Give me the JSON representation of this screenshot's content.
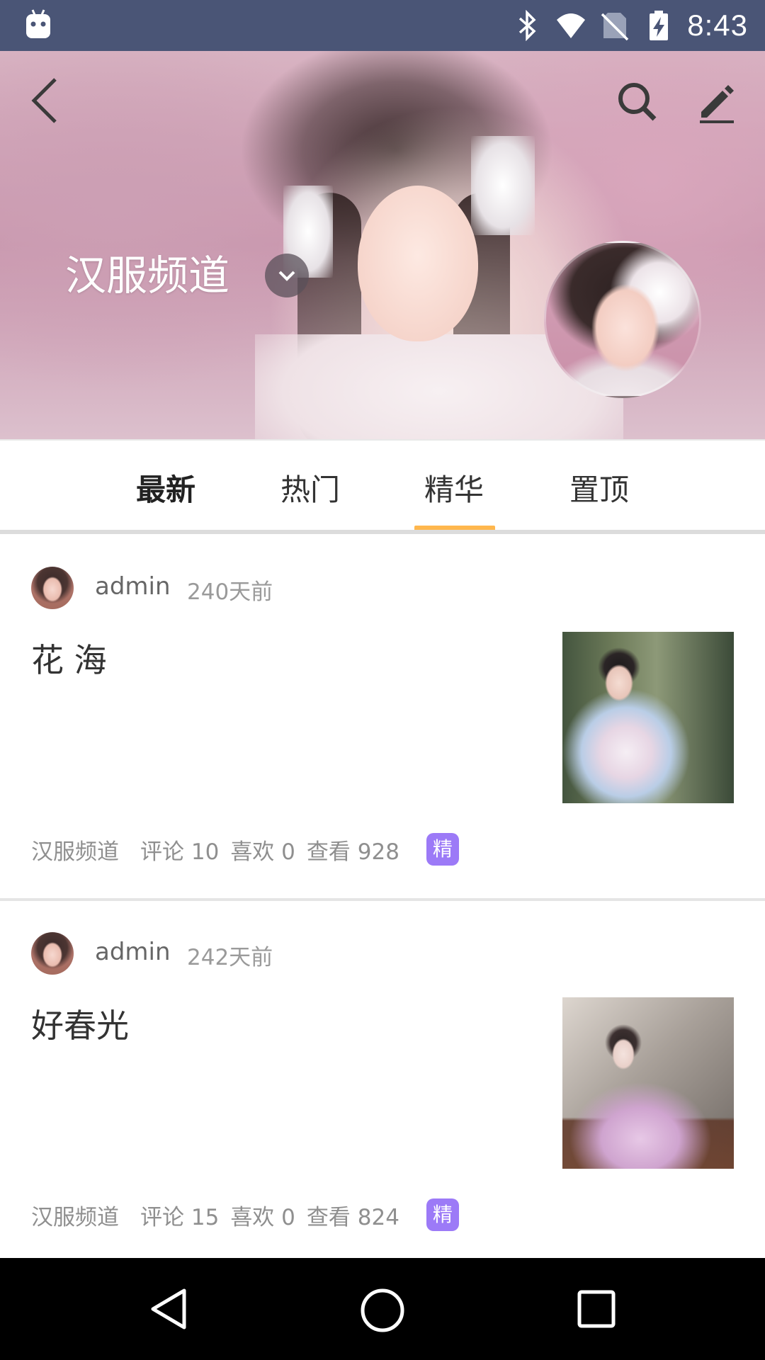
{
  "status_bar": {
    "time": "8:43",
    "icons": [
      "android-icon",
      "bluetooth-icon",
      "wifi-icon",
      "no-sim-icon",
      "battery-charging-icon"
    ]
  },
  "header": {
    "channel_title": "汉服频道",
    "icons": [
      "back-icon",
      "search-icon",
      "edit-icon",
      "chevron-down-icon"
    ]
  },
  "tabs": [
    {
      "label": "最新",
      "bold": true
    },
    {
      "label": "热门",
      "bold": false
    },
    {
      "label": "精华",
      "selected": true
    },
    {
      "label": "置顶",
      "bold": false
    }
  ],
  "accent_color": "#ffb74d",
  "badge_color": "#9c7af7",
  "posts": [
    {
      "author": "admin",
      "time": "240天前",
      "title": "花 海",
      "channel": "汉服频道",
      "comments": "评论 10",
      "likes": "喜欢 0",
      "views": "查看 928",
      "badge": "精"
    },
    {
      "author": "admin",
      "time": "242天前",
      "title": "好春光",
      "channel": "汉服频道",
      "comments": "评论 15",
      "likes": "喜欢 0",
      "views": "查看 824",
      "badge": "精"
    }
  ],
  "nav_bar": {
    "icons": [
      "nav-back-icon",
      "nav-home-icon",
      "nav-recents-icon"
    ]
  }
}
